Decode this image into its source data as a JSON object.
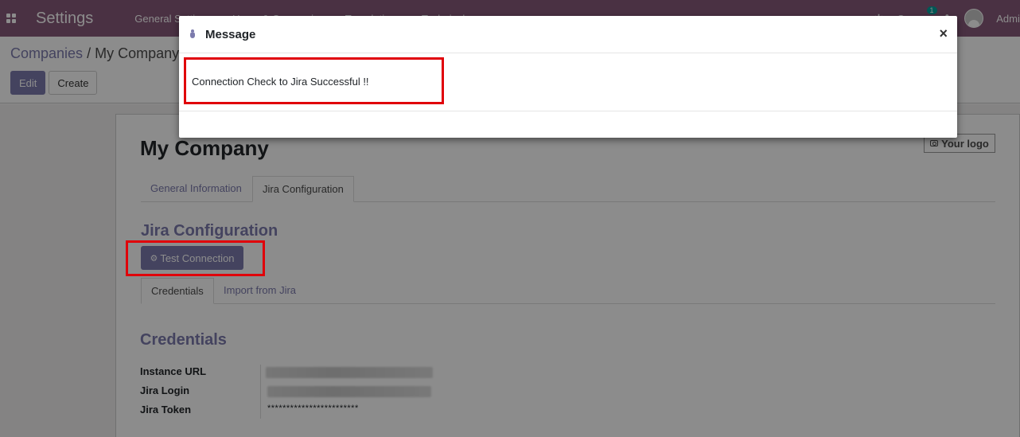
{
  "navbar": {
    "brand": "Settings",
    "menu": [
      "General Settings",
      "Users & Companies",
      "Translations",
      "Technical"
    ],
    "chat_badge": "1",
    "user_name": "Admini"
  },
  "breadcrumb": {
    "parent": "Companies",
    "separator": "/",
    "current": "My Company"
  },
  "toolbar": {
    "edit_label": "Edit",
    "create_label": "Create"
  },
  "form": {
    "company_name": "My Company",
    "logo_label": "Your logo",
    "tabs": [
      "General Information",
      "Jira Configuration"
    ],
    "jira_section_title": "Jira Configuration",
    "test_button": "Test Connection",
    "sub_tabs": [
      "Credentials",
      "Import from Jira"
    ],
    "credentials_title": "Credentials",
    "fields": [
      {
        "label": "Instance URL"
      },
      {
        "label": "Jira Login"
      },
      {
        "label": "Jira Token",
        "value": "************************"
      }
    ]
  },
  "dialog": {
    "title": "Message",
    "close_label": "×",
    "message": "Connection Check to Jira Successful !!"
  },
  "colors": {
    "navbar": "#875a7b",
    "accent": "#7c7bad",
    "highlight": "#e0000a"
  }
}
